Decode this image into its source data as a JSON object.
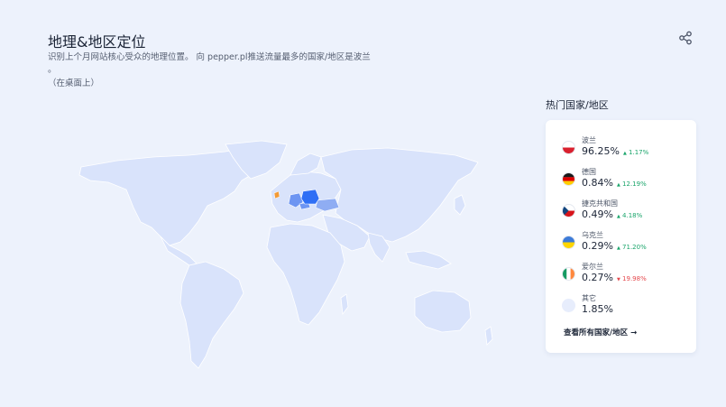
{
  "header": {
    "title": "地理&地区定位",
    "description": "识别上个月网站核心受众的地理位置。 向 pepper.pl推送流量最多的国家/地区是波兰",
    "dot": "。",
    "subnote": "（在桌面上）"
  },
  "top_countries": {
    "heading": "热门国家/地区",
    "items": [
      {
        "name": "波兰",
        "share": "96.25%",
        "change": "1.17%",
        "direction": "up",
        "arrow": "▲",
        "flag": "poland-flag-icon"
      },
      {
        "name": "德国",
        "share": "0.84%",
        "change": "12.19%",
        "direction": "up",
        "arrow": "▲",
        "flag": "germany-flag-icon"
      },
      {
        "name": "捷克共和国",
        "share": "0.49%",
        "change": "4.18%",
        "direction": "up",
        "arrow": "▲",
        "flag": "czech-flag-icon"
      },
      {
        "name": "乌克兰",
        "share": "0.29%",
        "change": "71.20%",
        "direction": "up",
        "arrow": "▲",
        "flag": "ukraine-flag-icon"
      },
      {
        "name": "爱尔兰",
        "share": "0.27%",
        "change": "19.98%",
        "direction": "down",
        "arrow": "▼",
        "flag": "ireland-flag-icon"
      },
      {
        "name": "其它",
        "share": "1.85%",
        "change": "",
        "direction": "",
        "arrow": "",
        "flag": "other-icon"
      }
    ],
    "view_all": "查看所有国家/地区 →"
  },
  "colors": {
    "map_default": "#d9e3fb",
    "map_highlight_main": "#2f6ff5",
    "map_highlight_secondary": "#6d95f2",
    "map_border": "#ffffff",
    "up": "#1aa56b",
    "down": "#e5484d"
  }
}
